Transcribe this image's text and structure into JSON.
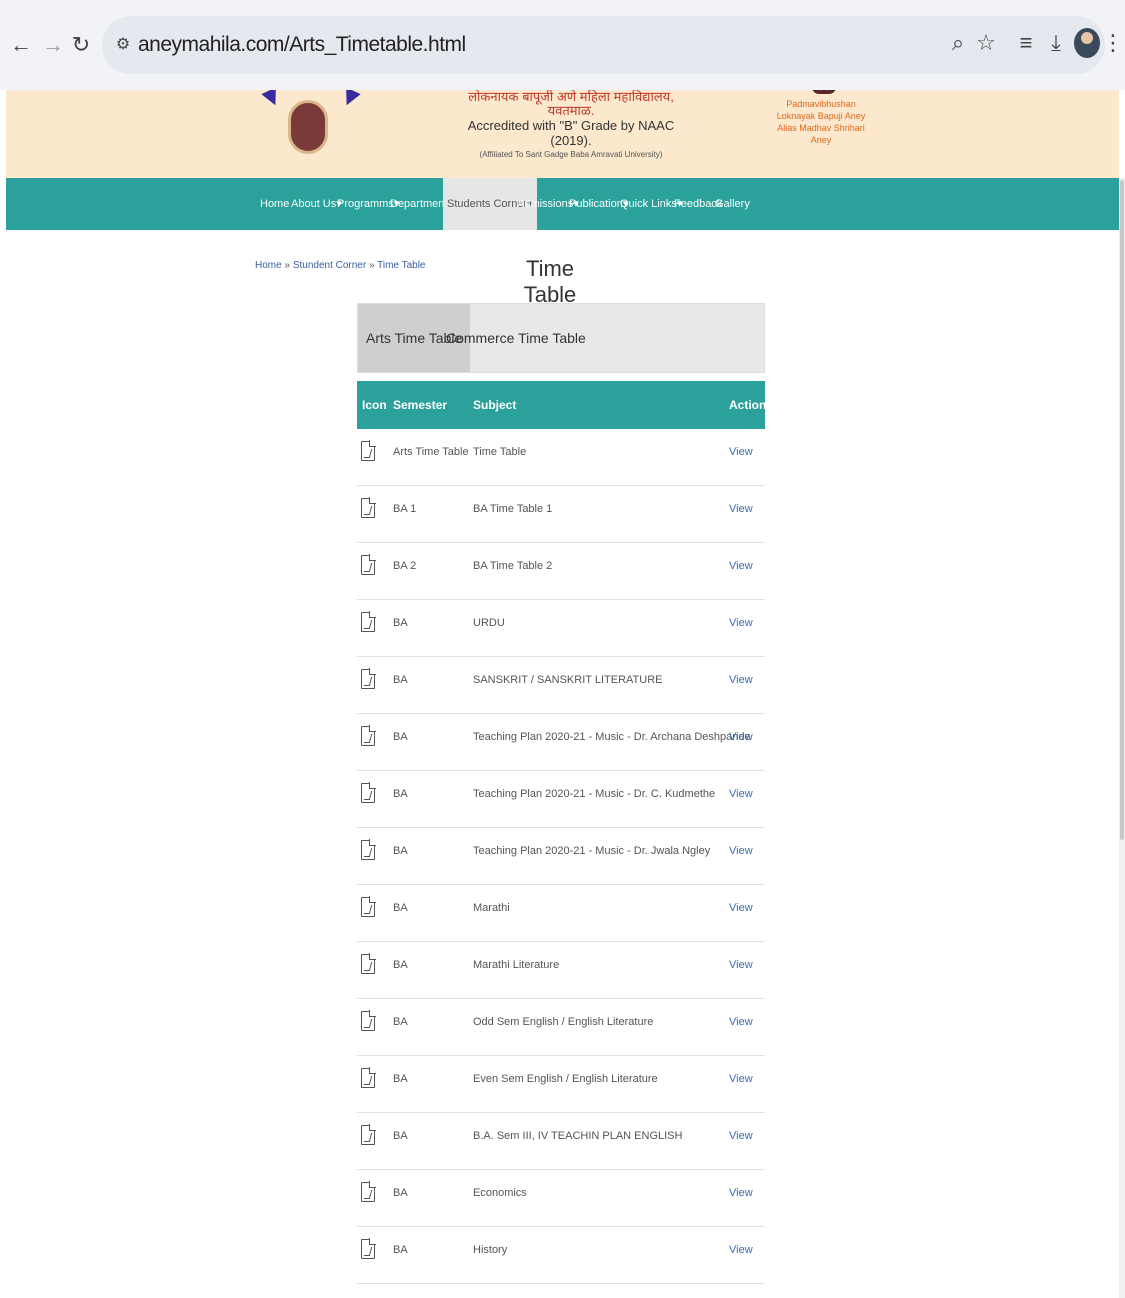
{
  "browser": {
    "url": "aneymahila.com/Arts_Timetable.html",
    "back_icon": "arrow-left-icon",
    "forward_icon": "arrow-right-icon",
    "reload_icon": "reload-icon",
    "site_info_icon": "tune-icon",
    "zoom_icon": "zoom-icon",
    "bookmark_icon": "star-icon",
    "reading_list_icon": "reading-list-icon",
    "download_icon": "download-icon",
    "menu_icon": "kebab-menu-icon"
  },
  "header": {
    "college_name": "लोकनायक बापूजी अणे महिला महाविद्यालय, यवतमाळ.",
    "accreditation": "Accredited with \"B\" Grade by NAAC (2019).",
    "affiliation": "(Affiliated To Sant Gadge Baba Amravati University)",
    "right_name": "Padmavibhushan Loknayak Bapuji Aney Alias Madhav Shrihari Aney"
  },
  "nav": {
    "items": [
      {
        "label": "Home"
      },
      {
        "label": "About Us▾"
      },
      {
        "label": "Programms▾"
      },
      {
        "label": "Departments▾"
      },
      {
        "label": "Students Corner▾",
        "active": true
      },
      {
        "label": "Admissions▾"
      },
      {
        "label": "Publication▾"
      },
      {
        "label": "Quick Links▾"
      },
      {
        "label": "Feedback"
      },
      {
        "label": "Gallery"
      }
    ]
  },
  "breadcrumb": {
    "home": "Home",
    "sep1": " » ",
    "section": "Stundent Corner",
    "sep2": " » ",
    "current": "Time Table"
  },
  "page_title": "Time Table",
  "tabs": [
    {
      "label": "Arts Time Table",
      "active": true
    },
    {
      "label": "Commerce Time Table",
      "active": false
    }
  ],
  "table": {
    "headers": {
      "icon": "Icon",
      "semester": "Semester",
      "subject": "Subject",
      "action": "Action"
    },
    "rows": [
      {
        "semester": "Arts Time Table",
        "subject": "Time Table",
        "action": "View"
      },
      {
        "semester": "BA 1",
        "subject": "BA Time Table 1",
        "action": "View"
      },
      {
        "semester": "BA 2",
        "subject": "BA Time Table 2",
        "action": "View"
      },
      {
        "semester": "BA",
        "subject": "URDU",
        "action": "View"
      },
      {
        "semester": "BA",
        "subject": "SANSKRIT / SANSKRIT LITERATURE",
        "action": "View"
      },
      {
        "semester": "BA",
        "subject": "Teaching Plan 2020-21 - Music - Dr. Archana Deshpande",
        "action": "View"
      },
      {
        "semester": "BA",
        "subject": "Teaching Plan 2020-21 - Music - Dr. C. Kudmethe",
        "action": "View"
      },
      {
        "semester": "BA",
        "subject": "Teaching Plan 2020-21 - Music - Dr. Jwala Ngley",
        "action": "View"
      },
      {
        "semester": "BA",
        "subject": "Marathi",
        "action": "View"
      },
      {
        "semester": "BA",
        "subject": "Marathi Literature",
        "action": "View"
      },
      {
        "semester": "BA",
        "subject": "Odd Sem English / English Literature",
        "action": "View"
      },
      {
        "semester": "BA",
        "subject": "Even Sem English / English Literature",
        "action": "View"
      },
      {
        "semester": "BA",
        "subject": "B.A. Sem III, IV TEACHIN PLAN ENGLISH",
        "action": "View"
      },
      {
        "semester": "BA",
        "subject": "Economics",
        "action": "View"
      },
      {
        "semester": "BA",
        "subject": "History",
        "action": "View"
      }
    ]
  },
  "colors": {
    "accent": "#2aa19a",
    "banner": "#fbe8cd",
    "link": "#3a6ab8"
  }
}
